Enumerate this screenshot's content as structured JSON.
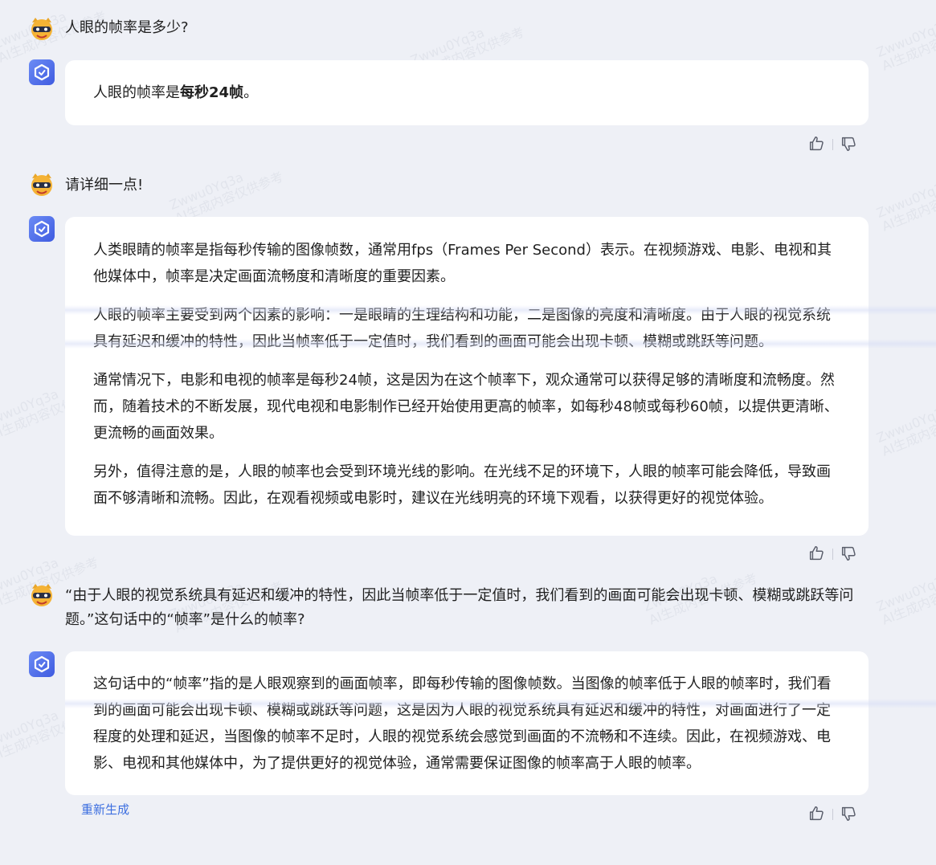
{
  "colors": {
    "page_background": "#eef0f6",
    "bubble_background": "#ffffff",
    "link_blue": "#3d6fe0",
    "bot_avatar_gradient": [
      "#6c8cf5",
      "#3f5be0"
    ]
  },
  "watermark": {
    "line1": "Zwwu0Yq3a",
    "line2": "AI生成内容仅供参考"
  },
  "conversation": [
    {
      "role": "user",
      "avatar_icon": "user-avatar-icon",
      "text": "人眼的帧率是多少?"
    },
    {
      "role": "assistant",
      "avatar_icon": "assistant-avatar-icon",
      "prefix": "人眼的帧率是",
      "bold": "每秒24帧",
      "suffix": "。"
    },
    {
      "role": "user",
      "avatar_icon": "user-avatar-icon",
      "text": "请详细一点!"
    },
    {
      "role": "assistant",
      "avatar_icon": "assistant-avatar-icon",
      "paragraphs": [
        "人类眼睛的帧率是指每秒传输的图像帧数，通常用fps（Frames Per Second）表示。在视频游戏、电影、电视和其他媒体中，帧率是决定画面流畅度和清晰度的重要因素。",
        "人眼的帧率主要受到两个因素的影响：一是眼睛的生理结构和功能，二是图像的亮度和清晰度。由于人眼的视觉系统具有延迟和缓冲的特性，因此当帧率低于一定值时，我们看到的画面可能会出现卡顿、模糊或跳跃等问题。",
        "通常情况下，电影和电视的帧率是每秒24帧，这是因为在这个帧率下，观众通常可以获得足够的清晰度和流畅度。然而，随着技术的不断发展，现代电视和电影制作已经开始使用更高的帧率，如每秒48帧或每秒60帧，以提供更清晰、更流畅的画面效果。",
        "另外，值得注意的是，人眼的帧率也会受到环境光线的影响。在光线不足的环境下，人眼的帧率可能会降低，导致画面不够清晰和流畅。因此，在观看视频或电影时，建议在光线明亮的环境下观看，以获得更好的视觉体验。"
      ]
    },
    {
      "role": "user",
      "avatar_icon": "user-avatar-icon",
      "text": "“由于人眼的视觉系统具有延迟和缓冲的特性，因此当帧率低于一定值时，我们看到的画面可能会出现卡顿、模糊或跳跃等问题。”这句话中的“帧率”是什么的帧率?"
    },
    {
      "role": "assistant",
      "avatar_icon": "assistant-avatar-icon",
      "paragraphs": [
        "这句话中的“帧率”指的是人眼观察到的画面帧率，即每秒传输的图像帧数。当图像的帧率低于人眼的帧率时，我们看到的画面可能会出现卡顿、模糊或跳跃等问题，这是因为人眼的视觉系统具有延迟和缓冲的特性，对画面进行了一定程度的处理和延迟，当图像的帧率不足时，人眼的视觉系统会感觉到画面的不流畅和不连续。因此，在视频游戏、电影、电视和其他媒体中，为了提供更好的视觉体验，通常需要保证图像的帧率高于人眼的帧率。"
      ]
    }
  ],
  "actions": {
    "regenerate_label": "重新生成",
    "like_icon": "thumbs-up-icon",
    "dislike_icon": "thumbs-down-icon"
  }
}
